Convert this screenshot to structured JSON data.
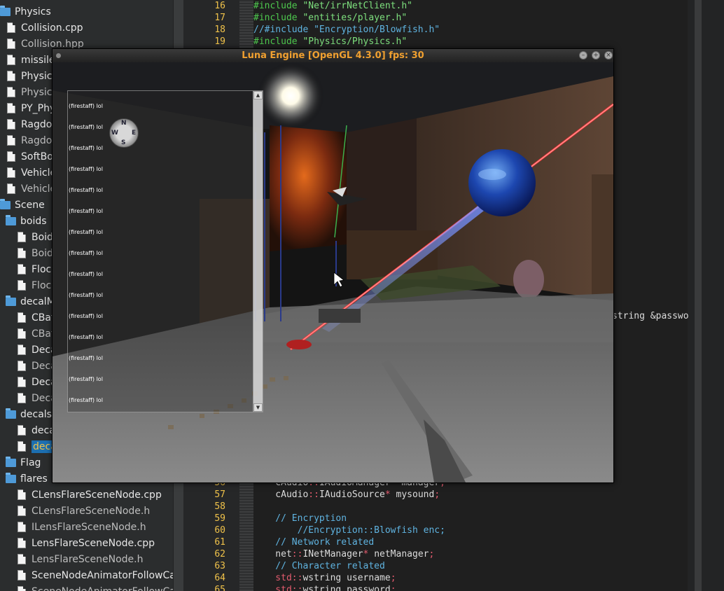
{
  "file_tree": {
    "rows": [
      {
        "type": "folder",
        "label": "Physics",
        "indent": 0,
        "dim": false
      },
      {
        "type": "file",
        "label": "Collision.cpp",
        "indent": 1,
        "dim": false
      },
      {
        "type": "file",
        "label": "Collision.hpp",
        "indent": 1,
        "dim": true
      },
      {
        "type": "file",
        "label": "missile",
        "indent": 1,
        "dim": false
      },
      {
        "type": "file",
        "label": "Physics",
        "indent": 1,
        "dim": false
      },
      {
        "type": "file",
        "label": "Physics",
        "indent": 1,
        "dim": true
      },
      {
        "type": "file",
        "label": "PY_Phy",
        "indent": 1,
        "dim": false
      },
      {
        "type": "file",
        "label": "Ragdol",
        "indent": 1,
        "dim": false
      },
      {
        "type": "file",
        "label": "Ragdol",
        "indent": 1,
        "dim": true
      },
      {
        "type": "file",
        "label": "SoftBo",
        "indent": 1,
        "dim": false
      },
      {
        "type": "file",
        "label": "Vehicle",
        "indent": 1,
        "dim": false
      },
      {
        "type": "file",
        "label": "Vehicle",
        "indent": 1,
        "dim": true
      },
      {
        "type": "folder",
        "label": "Scene",
        "indent": 0,
        "dim": false
      },
      {
        "type": "folder",
        "label": "boids",
        "indent": 1,
        "dim": false
      },
      {
        "type": "file",
        "label": "Boid",
        "indent": 2,
        "dim": false
      },
      {
        "type": "file",
        "label": "Boid",
        "indent": 2,
        "dim": true
      },
      {
        "type": "file",
        "label": "Flock",
        "indent": 2,
        "dim": false
      },
      {
        "type": "file",
        "label": "Flock",
        "indent": 2,
        "dim": true
      },
      {
        "type": "folder",
        "label": "decalM",
        "indent": 1,
        "dim": false
      },
      {
        "type": "file",
        "label": "CBat",
        "indent": 2,
        "dim": false
      },
      {
        "type": "file",
        "label": "CBat",
        "indent": 2,
        "dim": true
      },
      {
        "type": "file",
        "label": "Deca",
        "indent": 2,
        "dim": false
      },
      {
        "type": "file",
        "label": "Deca",
        "indent": 2,
        "dim": true
      },
      {
        "type": "file",
        "label": "Deca",
        "indent": 2,
        "dim": false
      },
      {
        "type": "file",
        "label": "Deca",
        "indent": 2,
        "dim": true
      },
      {
        "type": "folder",
        "label": "decals",
        "indent": 1,
        "dim": false
      },
      {
        "type": "file",
        "label": "deca",
        "indent": 2,
        "dim": false
      },
      {
        "type": "file",
        "label": "deca",
        "indent": 2,
        "dim": false,
        "selected": true
      },
      {
        "type": "folder",
        "label": "Flag",
        "indent": 1,
        "dim": false
      },
      {
        "type": "folder",
        "label": "flares",
        "indent": 1,
        "dim": false
      },
      {
        "type": "file",
        "label": "CLensFlareSceneNode.cpp",
        "indent": 2,
        "dim": false
      },
      {
        "type": "file",
        "label": "CLensFlareSceneNode.h",
        "indent": 2,
        "dim": true
      },
      {
        "type": "file",
        "label": "ILensFlareSceneNode.h",
        "indent": 2,
        "dim": true
      },
      {
        "type": "file",
        "label": "LensFlareSceneNode.cpp",
        "indent": 2,
        "dim": false
      },
      {
        "type": "file",
        "label": "LensFlareSceneNode.h",
        "indent": 2,
        "dim": true
      },
      {
        "type": "file",
        "label": "SceneNodeAnimatorFollowCam",
        "indent": 2,
        "dim": false
      },
      {
        "type": "file",
        "label": "SceneNodeAnimatorFollowCam",
        "indent": 2,
        "dim": true
      }
    ]
  },
  "editor": {
    "top_lines": [
      {
        "num": "16",
        "parts": [
          [
            "c-inc",
            "#include "
          ],
          [
            "c-str",
            "\"Net/irrNetClient.h\""
          ]
        ]
      },
      {
        "num": "17",
        "parts": [
          [
            "c-inc",
            "#include "
          ],
          [
            "c-str",
            "\"entities/player.h\""
          ]
        ]
      },
      {
        "num": "18",
        "parts": [
          [
            "c-cmt",
            "//#include \"Encryption/Blowfish.h\""
          ]
        ]
      },
      {
        "num": "19",
        "parts": [
          [
            "c-inc",
            "#include "
          ],
          [
            "c-str",
            "\"Physics/Physics.h\""
          ]
        ]
      }
    ],
    "side_fragment": "string &passwo",
    "bottom_lines": [
      {
        "num": "56",
        "parts": [
          [
            "c-txt",
            "    cAudio"
          ],
          [
            "c-op",
            "::"
          ],
          [
            "c-txt",
            "IAudioManager"
          ],
          [
            "c-op",
            "*"
          ],
          [
            "c-txt",
            " manager"
          ],
          [
            "c-op",
            ";"
          ]
        ]
      },
      {
        "num": "57",
        "parts": [
          [
            "c-txt",
            "    cAudio"
          ],
          [
            "c-op",
            "::"
          ],
          [
            "c-txt",
            "IAudioSource"
          ],
          [
            "c-op",
            "*"
          ],
          [
            "c-txt",
            " mysound"
          ],
          [
            "c-op",
            ";"
          ]
        ]
      },
      {
        "num": "58",
        "parts": []
      },
      {
        "num": "59",
        "parts": [
          [
            "c-cmt",
            "    // Encryption"
          ]
        ]
      },
      {
        "num": "60",
        "parts": [
          [
            "c-cmt",
            "        //Encryption::Blowfish enc;"
          ]
        ]
      },
      {
        "num": "61",
        "parts": [
          [
            "c-cmt",
            "    // Network related"
          ]
        ]
      },
      {
        "num": "62",
        "parts": [
          [
            "c-txt",
            "    net"
          ],
          [
            "c-op",
            "::"
          ],
          [
            "c-txt",
            "INetManager"
          ],
          [
            "c-op",
            "*"
          ],
          [
            "c-txt",
            " netManager"
          ],
          [
            "c-op",
            ";"
          ]
        ]
      },
      {
        "num": "63",
        "parts": [
          [
            "c-cmt",
            "    // Character related"
          ]
        ]
      },
      {
        "num": "64",
        "parts": [
          [
            "c-kw",
            "    std"
          ],
          [
            "c-op",
            "::"
          ],
          [
            "c-txt",
            "wstring username"
          ],
          [
            "c-op",
            ";"
          ]
        ]
      },
      {
        "num": "65",
        "parts": [
          [
            "c-kw",
            "    std"
          ],
          [
            "c-op",
            "::"
          ],
          [
            "c-txt",
            "wstring password"
          ],
          [
            "c-op",
            ";"
          ]
        ]
      }
    ]
  },
  "game_window": {
    "title": "Luna Engine [OpenGL 4.3.0] fps: 30",
    "buttons": {
      "minimize": "–",
      "maximize": "+",
      "close": "×"
    },
    "console_lines": [
      "(firestaff) lol",
      "(firestaff) lol",
      "(firestaff) lol",
      "(firestaff) lol",
      "(firestaff) lol",
      "(firestaff) lol",
      "(firestaff) lol",
      "(firestaff) lol",
      "(firestaff) lol",
      "(firestaff) lol",
      "(firestaff) lol",
      "(firestaff) lol",
      "(firestaff) lol",
      "(firestaff) lol",
      "(firestaff) lol"
    ],
    "console_scroll": {
      "up": "▲",
      "down": "▼"
    },
    "compass": {
      "n": "N",
      "s": "S",
      "e": "E",
      "w": "W"
    }
  }
}
